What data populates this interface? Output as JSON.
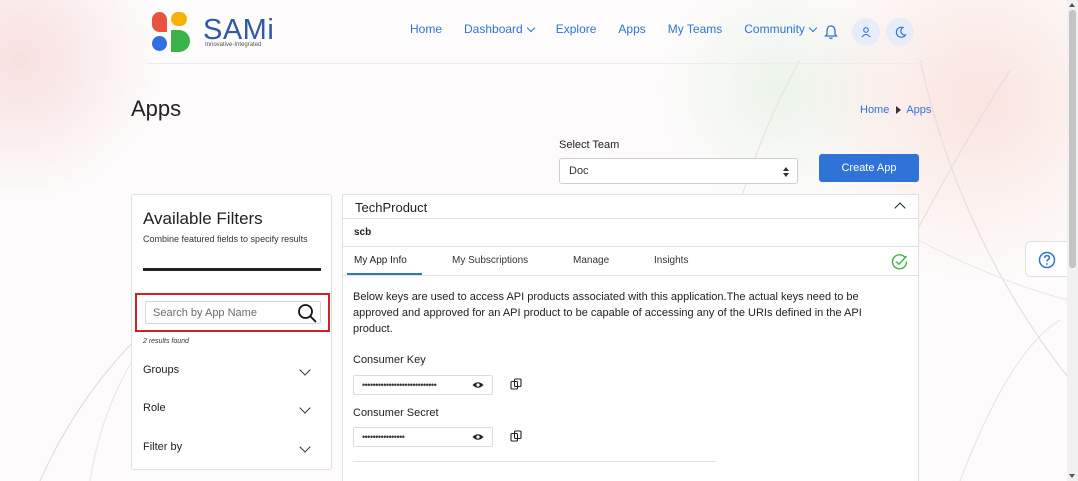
{
  "brand": {
    "name": "SAMi",
    "tagline": "Innovative-Integrated",
    "colors": {
      "red": "#e8533f",
      "yellow": "#f5b300",
      "blue": "#2f6fe0",
      "green": "#3ab34a"
    }
  },
  "nav": {
    "items": [
      {
        "label": "Home",
        "dropdown": false
      },
      {
        "label": "Dashboard",
        "dropdown": true
      },
      {
        "label": "Explore",
        "dropdown": false
      },
      {
        "label": "Apps",
        "dropdown": false
      },
      {
        "label": "My Teams",
        "dropdown": false
      },
      {
        "label": "Community",
        "dropdown": true
      }
    ],
    "icons": [
      "bell-icon",
      "user-icon",
      "moon-icon"
    ]
  },
  "page": {
    "title": "Apps",
    "breadcrumb": [
      "Home",
      "Apps"
    ]
  },
  "team": {
    "label": "Select Team",
    "selected": "Doc"
  },
  "actions": {
    "create_app": "Create App"
  },
  "filters": {
    "title": "Available Filters",
    "subtitle": "Combine featured fields to specify results",
    "search_placeholder": "Search by App Name",
    "results": "2 results found",
    "groups": [
      "Groups",
      "Role",
      "Filter by"
    ]
  },
  "app": {
    "name": "TechProduct",
    "subtitle": "scb",
    "tabs": [
      "My App Info",
      "My Subscriptions",
      "Manage",
      "Insights"
    ],
    "active_tab": "My App Info",
    "description": "Below keys are used to access API products associated with this application.The actual keys need to be approved and approved for an API product to be capable of accessing any of the URIs defined in the API product.",
    "consumer_key_label": "Consumer Key",
    "consumer_key_value": "••••••••••••••••••••••••••••",
    "consumer_secret_label": "Consumer Secret",
    "consumer_secret_value": "••••••••••••••••"
  },
  "colors": {
    "accent": "#2f73d9",
    "highlight": "#d21f2a",
    "success": "#3ab34a"
  }
}
